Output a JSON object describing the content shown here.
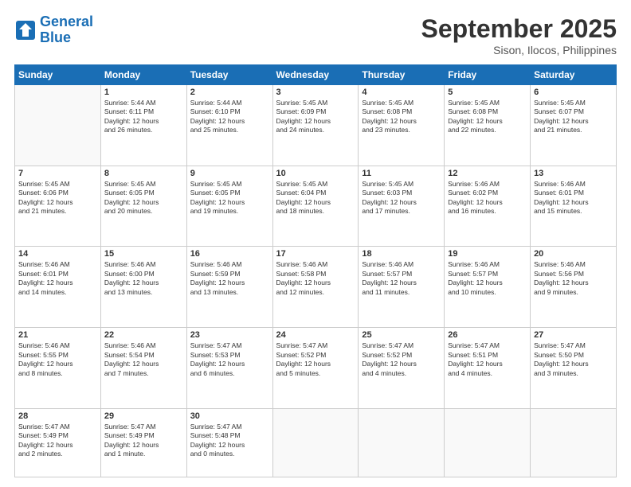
{
  "header": {
    "logo_line1": "General",
    "logo_line2": "Blue",
    "month": "September 2025",
    "location": "Sison, Ilocos, Philippines"
  },
  "weekdays": [
    "Sunday",
    "Monday",
    "Tuesday",
    "Wednesday",
    "Thursday",
    "Friday",
    "Saturday"
  ],
  "weeks": [
    [
      {
        "day": "",
        "info": ""
      },
      {
        "day": "1",
        "info": "Sunrise: 5:44 AM\nSunset: 6:11 PM\nDaylight: 12 hours\nand 26 minutes."
      },
      {
        "day": "2",
        "info": "Sunrise: 5:44 AM\nSunset: 6:10 PM\nDaylight: 12 hours\nand 25 minutes."
      },
      {
        "day": "3",
        "info": "Sunrise: 5:45 AM\nSunset: 6:09 PM\nDaylight: 12 hours\nand 24 minutes."
      },
      {
        "day": "4",
        "info": "Sunrise: 5:45 AM\nSunset: 6:08 PM\nDaylight: 12 hours\nand 23 minutes."
      },
      {
        "day": "5",
        "info": "Sunrise: 5:45 AM\nSunset: 6:08 PM\nDaylight: 12 hours\nand 22 minutes."
      },
      {
        "day": "6",
        "info": "Sunrise: 5:45 AM\nSunset: 6:07 PM\nDaylight: 12 hours\nand 21 minutes."
      }
    ],
    [
      {
        "day": "7",
        "info": "Sunrise: 5:45 AM\nSunset: 6:06 PM\nDaylight: 12 hours\nand 21 minutes."
      },
      {
        "day": "8",
        "info": "Sunrise: 5:45 AM\nSunset: 6:05 PM\nDaylight: 12 hours\nand 20 minutes."
      },
      {
        "day": "9",
        "info": "Sunrise: 5:45 AM\nSunset: 6:05 PM\nDaylight: 12 hours\nand 19 minutes."
      },
      {
        "day": "10",
        "info": "Sunrise: 5:45 AM\nSunset: 6:04 PM\nDaylight: 12 hours\nand 18 minutes."
      },
      {
        "day": "11",
        "info": "Sunrise: 5:45 AM\nSunset: 6:03 PM\nDaylight: 12 hours\nand 17 minutes."
      },
      {
        "day": "12",
        "info": "Sunrise: 5:46 AM\nSunset: 6:02 PM\nDaylight: 12 hours\nand 16 minutes."
      },
      {
        "day": "13",
        "info": "Sunrise: 5:46 AM\nSunset: 6:01 PM\nDaylight: 12 hours\nand 15 minutes."
      }
    ],
    [
      {
        "day": "14",
        "info": "Sunrise: 5:46 AM\nSunset: 6:01 PM\nDaylight: 12 hours\nand 14 minutes."
      },
      {
        "day": "15",
        "info": "Sunrise: 5:46 AM\nSunset: 6:00 PM\nDaylight: 12 hours\nand 13 minutes."
      },
      {
        "day": "16",
        "info": "Sunrise: 5:46 AM\nSunset: 5:59 PM\nDaylight: 12 hours\nand 13 minutes."
      },
      {
        "day": "17",
        "info": "Sunrise: 5:46 AM\nSunset: 5:58 PM\nDaylight: 12 hours\nand 12 minutes."
      },
      {
        "day": "18",
        "info": "Sunrise: 5:46 AM\nSunset: 5:57 PM\nDaylight: 12 hours\nand 11 minutes."
      },
      {
        "day": "19",
        "info": "Sunrise: 5:46 AM\nSunset: 5:57 PM\nDaylight: 12 hours\nand 10 minutes."
      },
      {
        "day": "20",
        "info": "Sunrise: 5:46 AM\nSunset: 5:56 PM\nDaylight: 12 hours\nand 9 minutes."
      }
    ],
    [
      {
        "day": "21",
        "info": "Sunrise: 5:46 AM\nSunset: 5:55 PM\nDaylight: 12 hours\nand 8 minutes."
      },
      {
        "day": "22",
        "info": "Sunrise: 5:46 AM\nSunset: 5:54 PM\nDaylight: 12 hours\nand 7 minutes."
      },
      {
        "day": "23",
        "info": "Sunrise: 5:47 AM\nSunset: 5:53 PM\nDaylight: 12 hours\nand 6 minutes."
      },
      {
        "day": "24",
        "info": "Sunrise: 5:47 AM\nSunset: 5:52 PM\nDaylight: 12 hours\nand 5 minutes."
      },
      {
        "day": "25",
        "info": "Sunrise: 5:47 AM\nSunset: 5:52 PM\nDaylight: 12 hours\nand 4 minutes."
      },
      {
        "day": "26",
        "info": "Sunrise: 5:47 AM\nSunset: 5:51 PM\nDaylight: 12 hours\nand 4 minutes."
      },
      {
        "day": "27",
        "info": "Sunrise: 5:47 AM\nSunset: 5:50 PM\nDaylight: 12 hours\nand 3 minutes."
      }
    ],
    [
      {
        "day": "28",
        "info": "Sunrise: 5:47 AM\nSunset: 5:49 PM\nDaylight: 12 hours\nand 2 minutes."
      },
      {
        "day": "29",
        "info": "Sunrise: 5:47 AM\nSunset: 5:49 PM\nDaylight: 12 hours\nand 1 minute."
      },
      {
        "day": "30",
        "info": "Sunrise: 5:47 AM\nSunset: 5:48 PM\nDaylight: 12 hours\nand 0 minutes."
      },
      {
        "day": "",
        "info": ""
      },
      {
        "day": "",
        "info": ""
      },
      {
        "day": "",
        "info": ""
      },
      {
        "day": "",
        "info": ""
      }
    ]
  ]
}
